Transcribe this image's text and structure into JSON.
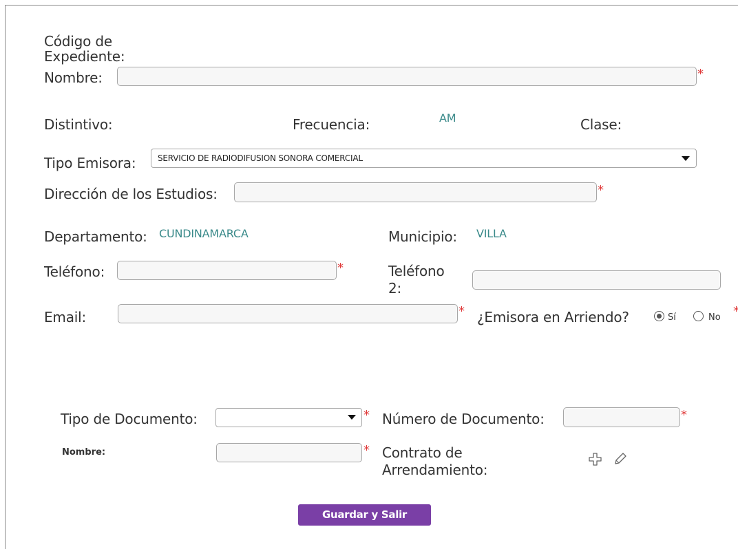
{
  "form": {
    "codigo_label": "Código de Expediente:",
    "nombre_label": "Nombre:",
    "nombre_value": "",
    "distintivo_label": "Distintivo:",
    "distintivo_value": "",
    "frecuencia_label": "Frecuencia:",
    "frecuencia_value": "AM",
    "clase_label": "Clase:",
    "clase_value": "",
    "tipo_emisora_label": "Tipo Emisora:",
    "tipo_emisora_value": "SERVICIO DE RADIODIFUSION SONORA COMERCIAL",
    "direccion_label": "Dirección de los Estudios:",
    "direccion_value": "",
    "departamento_label": "Departamento:",
    "departamento_value": "CUNDINAMARCA",
    "municipio_label": "Municipio:",
    "municipio_value": "VILLA",
    "telefono_label": "Teléfono:",
    "telefono_value": "",
    "telefono2_label": "Teléfono 2:",
    "telefono2_value": "",
    "email_label": "Email:",
    "email_value": "",
    "arriendo_label": "¿Emisora en Arriendo?",
    "arriendo_options": [
      "Sí",
      "No"
    ],
    "arriendo_selected": "Sí",
    "required_mark": "*"
  },
  "arrendamiento": {
    "tipo_documento_label": "Tipo de Documento:",
    "tipo_documento_value": "",
    "numero_documento_label": "Número de Documento:",
    "numero_documento_value": "",
    "nombre_label": "Nombre:",
    "nombre_value": "",
    "contrato_label": "Contrato de Arrendamiento:",
    "contrato_icons": [
      "add-icon",
      "edit-icon"
    ]
  },
  "actions": {
    "save_exit_label": "Guardar y Salir"
  },
  "colors": {
    "accent": "#7a3fa6",
    "required": "#e03a3a",
    "value_text": "#3a8a8a"
  }
}
